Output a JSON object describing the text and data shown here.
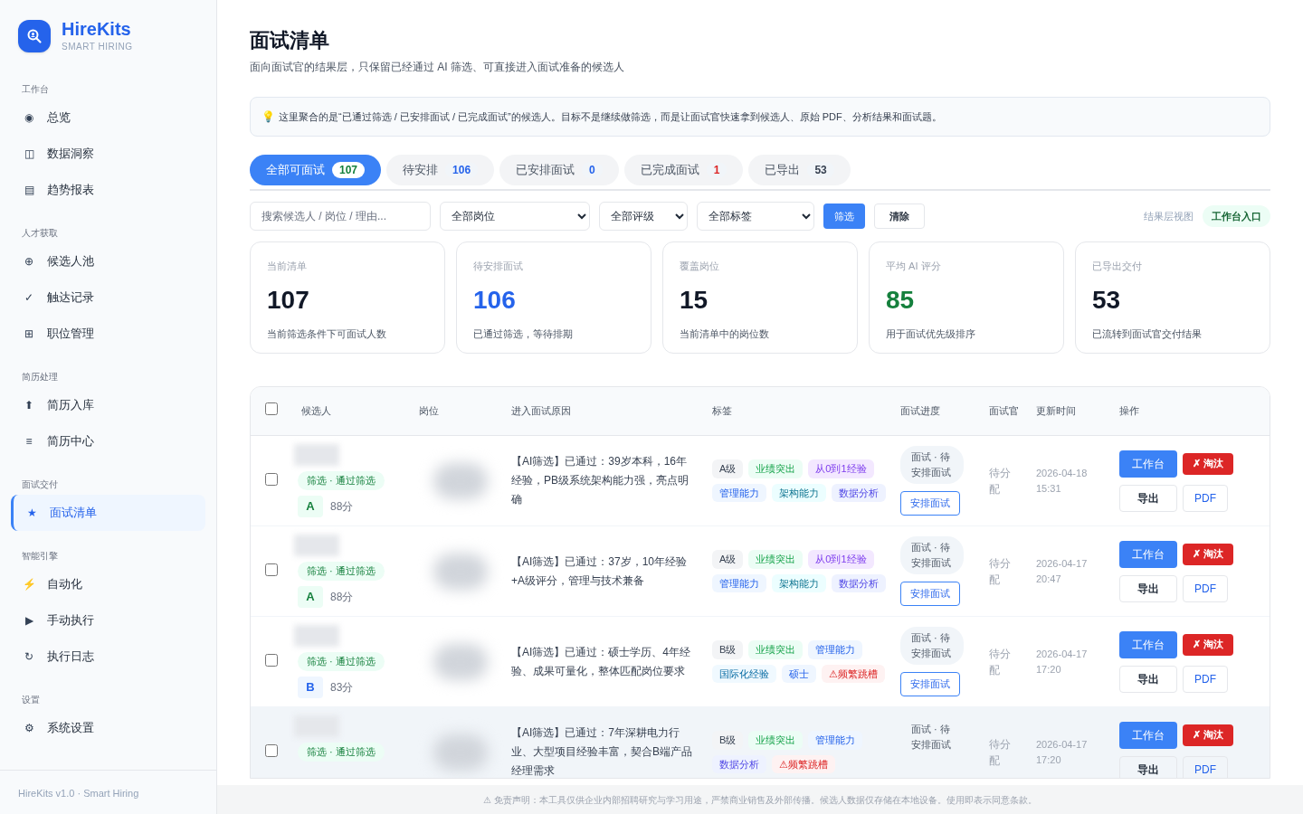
{
  "brand": {
    "name": "HireKits",
    "tagline": "SMART HIRING"
  },
  "sidebar": {
    "sections": [
      {
        "title": "工作台",
        "items": [
          {
            "icon": "◉",
            "label": "总览",
            "selected": false
          },
          {
            "icon": "◫",
            "label": "数据洞察",
            "selected": false
          },
          {
            "icon": "▤",
            "label": "趋势报表",
            "selected": false
          }
        ]
      },
      {
        "title": "人才获取",
        "items": [
          {
            "icon": "⊕",
            "label": "候选人池",
            "selected": false
          },
          {
            "icon": "✓",
            "label": "触达记录",
            "selected": false
          },
          {
            "icon": "⊞",
            "label": "职位管理",
            "selected": false
          }
        ]
      },
      {
        "title": "简历处理",
        "items": [
          {
            "icon": "⬆",
            "label": "简历入库",
            "selected": false
          },
          {
            "icon": "≡",
            "label": "简历中心",
            "selected": false
          }
        ]
      },
      {
        "title": "面试交付",
        "items": [
          {
            "icon": "★",
            "label": "面试清单",
            "selected": true
          }
        ]
      },
      {
        "title": "智能引擎",
        "items": [
          {
            "icon": "⚡",
            "label": "自动化",
            "selected": false
          },
          {
            "icon": "▶",
            "label": "手动执行",
            "selected": false
          },
          {
            "icon": "↻",
            "label": "执行日志",
            "selected": false
          }
        ]
      },
      {
        "title": "设置",
        "items": [
          {
            "icon": "⚙",
            "label": "系统设置",
            "selected": false
          }
        ]
      }
    ],
    "footer": "HireKits v1.0 · Smart Hiring"
  },
  "page": {
    "title": "面试清单",
    "subtitle": "面向面试官的结果层，只保留已经通过 AI 筛选、可直接进入面试准备的候选人"
  },
  "notice": {
    "icon": "💡",
    "text": "这里聚合的是“已通过筛选 / 已安排面试 / 已完成面试”的候选人。目标不是继续做筛选，而是让面试官快速拿到候选人、原始 PDF、分析结果和面试题。"
  },
  "tabs": [
    {
      "label": "全部可面试",
      "count": "107",
      "color": "#15803d",
      "selected": true
    },
    {
      "label": "待安排",
      "count": "106",
      "color": "#2563eb",
      "selected": false
    },
    {
      "label": "已安排面试",
      "count": "0",
      "color": "#2563eb",
      "selected": false
    },
    {
      "label": "已完成面试",
      "count": "1",
      "color": "#dc2626",
      "selected": false
    },
    {
      "label": "已导出",
      "count": "53",
      "color": "#374151",
      "selected": false
    }
  ],
  "filters": {
    "search": {
      "placeholder": "搜索候选人 / 岗位 / 理由..."
    },
    "selects": [
      "全部岗位",
      "全部评级",
      "全部标签"
    ],
    "filter_button": "筛选",
    "clear_button": "清除",
    "view_label": "结果层视图",
    "entry_badge": "工作台入口"
  },
  "stats": [
    {
      "label": "当前清单",
      "value": "107",
      "note": "当前筛选条件下可面试人数",
      "color": "#111827"
    },
    {
      "label": "待安排面试",
      "value": "106",
      "note": "已通过筛选，等待排期",
      "color": "#2563eb"
    },
    {
      "label": "覆盖岗位",
      "value": "15",
      "note": "当前清单中的岗位数",
      "color": "#111827"
    },
    {
      "label": "平均 AI 评分",
      "value": "85",
      "note": "用于面试优先级排序",
      "color": "#15803d"
    },
    {
      "label": "已导出交付",
      "value": "53",
      "note": "已流转到面试官交付结果",
      "color": "#111827"
    }
  ],
  "table": {
    "select_all_checked": false,
    "columns": [
      "候选人",
      "岗位",
      "进入面试原因",
      "标签",
      "面试进度",
      "面试官",
      "更新时间",
      "操作"
    ],
    "rows": [
      {
        "checked": false,
        "hovered": false,
        "status": "筛选 · 通过筛选",
        "grade": {
          "text": "A",
          "kind": "a"
        },
        "score": "88分",
        "reason": "【AI筛选】已通过：39岁本科，16年经验，PB级系统架构能力强，亮点明确",
        "tags": [
          {
            "text": "A级",
            "kind": "grade"
          },
          {
            "text": "业绩突出",
            "kind": "good"
          },
          {
            "text": "从0到1经验",
            "kind": "purple"
          },
          {
            "text": "管理能力",
            "kind": "blue"
          },
          {
            "text": "架构能力",
            "kind": "cyan"
          },
          {
            "text": "数据分析",
            "kind": "indigo"
          }
        ],
        "progress": "面试 · 待安排面试",
        "schedule": "安排面试",
        "interviewer": "待分配",
        "updated": "2026-04-18 15:31",
        "actions": {
          "workbench": "工作台",
          "reject": "✗ 淘汰",
          "export": "导出",
          "pdf": "PDF"
        }
      },
      {
        "checked": false,
        "hovered": false,
        "status": "筛选 · 通过筛选",
        "grade": {
          "text": "A",
          "kind": "a"
        },
        "score": "88分",
        "reason": "【AI筛选】已通过：37岁，10年经验+A级评分，管理与技术兼备",
        "tags": [
          {
            "text": "A级",
            "kind": "grade"
          },
          {
            "text": "业绩突出",
            "kind": "good"
          },
          {
            "text": "从0到1经验",
            "kind": "purple"
          },
          {
            "text": "管理能力",
            "kind": "blue"
          },
          {
            "text": "架构能力",
            "kind": "cyan"
          },
          {
            "text": "数据分析",
            "kind": "indigo"
          }
        ],
        "progress": "面试 · 待安排面试",
        "schedule": "安排面试",
        "interviewer": "待分配",
        "updated": "2026-04-17 20:47",
        "actions": {
          "workbench": "工作台",
          "reject": "✗ 淘汰",
          "export": "导出",
          "pdf": "PDF"
        }
      },
      {
        "checked": false,
        "hovered": false,
        "status": "筛选 · 通过筛选",
        "grade": {
          "text": "B",
          "kind": "b"
        },
        "score": "83分",
        "reason": "【AI筛选】已通过：硕士学历、4年经验、成果可量化，整体匹配岗位要求",
        "tags": [
          {
            "text": "B级",
            "kind": "grade"
          },
          {
            "text": "业绩突出",
            "kind": "good"
          },
          {
            "text": "管理能力",
            "kind": "blue"
          },
          {
            "text": "国际化经验",
            "kind": "sky"
          },
          {
            "text": "硕士",
            "kind": "blue"
          },
          {
            "text": "⚠频繁跳槽",
            "kind": "warn"
          }
        ],
        "progress": "面试 · 待安排面试",
        "schedule": "安排面试",
        "interviewer": "待分配",
        "updated": "2026-04-17 17:20",
        "actions": {
          "workbench": "工作台",
          "reject": "✗ 淘汰",
          "export": "导出",
          "pdf": "PDF"
        }
      },
      {
        "checked": false,
        "hovered": true,
        "status": "筛选 · 通过筛选",
        "reason": "【AI筛选】已通过：7年深耕电力行业、大型项目经验丰富，契合B端产品经理需求",
        "tags": [
          {
            "text": "B级",
            "kind": "grade"
          },
          {
            "text": "业绩突出",
            "kind": "good"
          },
          {
            "text": "管理能力",
            "kind": "blue"
          },
          {
            "text": "数据分析",
            "kind": "indigo"
          },
          {
            "text": "⚠频繁跳槽",
            "kind": "warn"
          }
        ],
        "progress": "面试 · 待安排面试",
        "interviewer": "待分配",
        "updated": "2026-04-17 17:20",
        "actions": {
          "workbench": "工作台",
          "reject": "✗ 淘汰",
          "export": "导出",
          "pdf": "PDF"
        }
      }
    ]
  },
  "disclaimer": "⚠ 免责声明：本工具仅供企业内部招聘研究与学习用途，严禁商业销售及外部传播。候选人数据仅存储在本地设备。使用即表示同意条款。"
}
